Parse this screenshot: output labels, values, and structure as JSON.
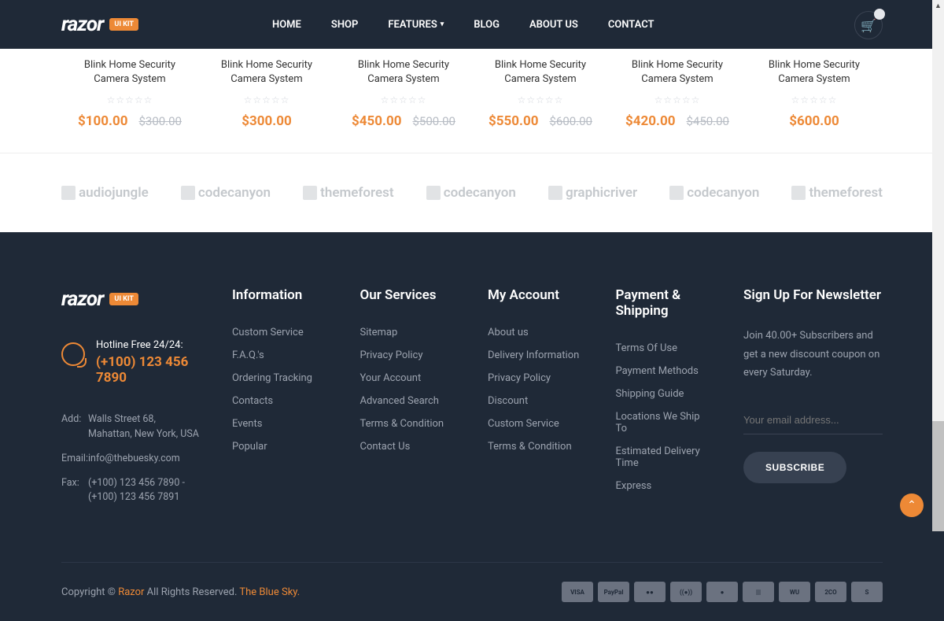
{
  "header": {
    "logo_text": "razor",
    "logo_badge": "UI KIT",
    "nav": [
      "HOME",
      "SHOP",
      "FEATURES",
      "BLOG",
      "ABOUT US",
      "CONTACT"
    ]
  },
  "products": [
    {
      "title": "Blink Home Security Camera System",
      "price": "$100.00",
      "old_price": "$300.00"
    },
    {
      "title": "Blink Home Security Camera System",
      "price": "$300.00",
      "old_price": ""
    },
    {
      "title": "Blink Home Security Camera System",
      "price": "$450.00",
      "old_price": "$500.00"
    },
    {
      "title": "Blink Home Security Camera System",
      "price": "$550.00",
      "old_price": "$600.00"
    },
    {
      "title": "Blink Home Security Camera System",
      "price": "$420.00",
      "old_price": "$450.00"
    },
    {
      "title": "Blink Home Security Camera System",
      "price": "$600.00",
      "old_price": ""
    }
  ],
  "brands": [
    "audiojungle",
    "codecanyon",
    "themeforest",
    "codecanyon",
    "graphicriver",
    "codecanyon",
    "themeforest"
  ],
  "footer": {
    "hotline_label": "Hotline Free 24/24:",
    "hotline_number": "(+100) 123 456 7890",
    "contact": {
      "add_label": "Add:",
      "add_value": "Walls Street 68, Mahattan, New York, USA",
      "email_label": "Email:",
      "email_value": "info@thebuesky.com",
      "fax_label": "Fax:",
      "fax_value": "(+100) 123 456 7890 - (+100) 123 456 7891"
    },
    "cols": [
      {
        "title": "Information",
        "links": [
          "Custom Service",
          "F.A.Q.'s",
          "Ordering Tracking",
          "Contacts",
          "Events",
          "Popular"
        ]
      },
      {
        "title": "Our Services",
        "links": [
          "Sitemap",
          "Privacy Policy",
          "Your Account",
          "Advanced Search",
          "Terms & Condition",
          "Contact Us"
        ]
      },
      {
        "title": "My Account",
        "links": [
          "About us",
          "Delivery Information",
          "Privacy Policy",
          "Discount",
          "Custom Service",
          "Terms & Condition"
        ]
      },
      {
        "title": "Payment & Shipping",
        "links": [
          "Terms Of Use",
          "Payment Methods",
          "Shipping Guide",
          "Locations We Ship To",
          "Estimated Delivery Time",
          "Express"
        ]
      }
    ],
    "newsletter": {
      "title": "Sign Up For Newsletter",
      "text": "Join 40.00+ Subscribers and get a new discount coupon on every Saturday.",
      "placeholder": "Your email address...",
      "button": "SUBSCRIBE"
    },
    "copyright_prefix": "Copyright © ",
    "copyright_brand": "Razor",
    "copyright_mid": " All Rights Reserved. ",
    "copyright_company": "The Blue Sky.",
    "payments": [
      "VISA",
      "PayPal",
      "●●",
      "((●))",
      "●",
      "|||",
      "WU",
      "2CO",
      "S"
    ]
  }
}
